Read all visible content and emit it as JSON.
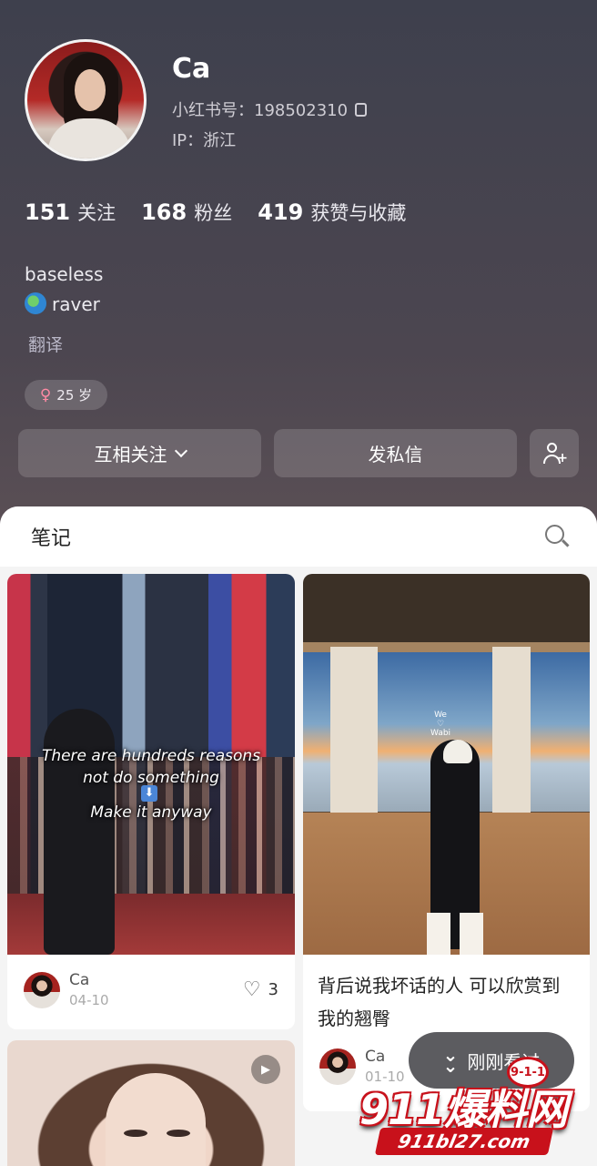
{
  "profile": {
    "name": "Ca",
    "id_label": "小红书号：198502310",
    "ip_label": "IP：浙江",
    "stats": [
      {
        "num": "151",
        "label": "关注"
      },
      {
        "num": "168",
        "label": "粉丝"
      },
      {
        "num": "419",
        "label": "获赞与收藏"
      }
    ],
    "bio_line1": "baseless",
    "bio_line2": "raver",
    "translate": "翻译",
    "age_tag": "25 岁",
    "female_symbol": "♀",
    "follow_button": "互相关注",
    "message_button": "发私信"
  },
  "notes": {
    "tab_title": "笔记",
    "cards": [
      {
        "caption1": "There are hundreds reasons",
        "caption2": "not do something",
        "caption3": "Make it anyway",
        "arrow_glyph": "⬇",
        "author": "Ca",
        "date": "04-10",
        "likes": "3"
      },
      {
        "sign_text_1": "We",
        "sign_text_2": "♡",
        "sign_text_3": "Wabi",
        "title": "背后说我坏话的人 可以欣赏到我的翘臀",
        "author": "Ca",
        "date": "01-10"
      },
      {
        "play_glyph": "▶"
      }
    ]
  },
  "floating": {
    "just_seen": "刚刚看过"
  },
  "watermark": {
    "main": "911爆料网",
    "badge": "9-1-1",
    "url": "911bl27.com"
  },
  "icons": {
    "heart": "♡",
    "globe": "globe-icon"
  },
  "colors": {
    "sheet_bg": "#f4f4f4",
    "watermark_red": "#c8111b"
  }
}
